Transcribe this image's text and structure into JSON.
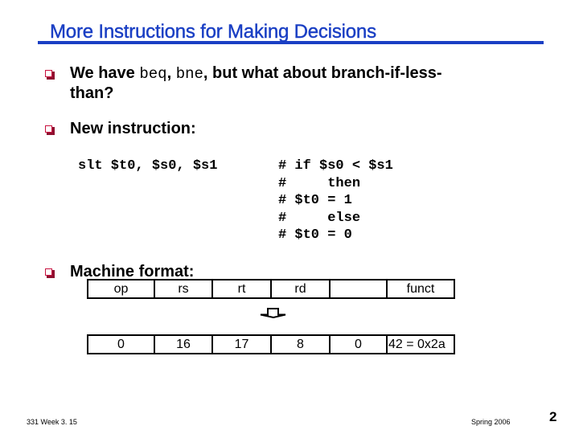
{
  "slide": {
    "title": "More Instructions for Making Decisions",
    "colors": {
      "title": "#1a3fc4",
      "bullet": "#c8103e"
    },
    "bullets": [
      {
        "icon": "square-bullet-icon",
        "parts": [
          "We have ",
          "beq",
          ", ",
          "bne",
          ", but what about branch-if-less-"
        ],
        "continuation": "than?"
      },
      {
        "icon": "square-bullet-icon",
        "text": "New instruction:"
      },
      {
        "icon": "square-bullet-icon",
        "text": "Machine format:"
      }
    ],
    "code": {
      "instruction": "slt $t0, $s0, $s1",
      "comments": [
        "# if $s0 < $s1",
        "#     then",
        "# $t0 = 1",
        "#     else",
        "# $t0 = 0"
      ]
    },
    "format_table": {
      "fields": [
        "op",
        "rs",
        "rt",
        "rd",
        "",
        "funct"
      ],
      "values": [
        "0",
        "16",
        "17",
        "8",
        "0",
        "42 = 0x2a"
      ]
    },
    "arrow_icon": "down-arrow-icon",
    "footer": {
      "left": "331 Week 3. 15",
      "right": "Spring 2006",
      "page_number": "2"
    }
  }
}
